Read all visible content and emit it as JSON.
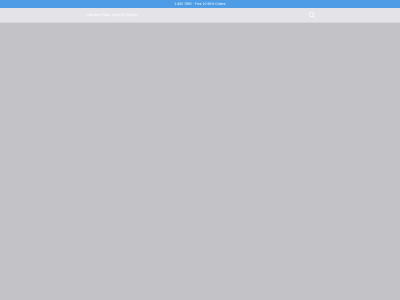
{
  "promo": {
    "text": "1-800 7890 · Free 10 50% Orders"
  },
  "nav": {
    "links": [
      {
        "label": "Collection Picks"
      },
      {
        "label": "Shop by Recipes"
      }
    ],
    "search_icon": "search-icon"
  },
  "colors": {
    "promo_bar": "#4e9ce6",
    "nav_bar": "#e4e3e7",
    "overlay": "#c3c2c7"
  }
}
